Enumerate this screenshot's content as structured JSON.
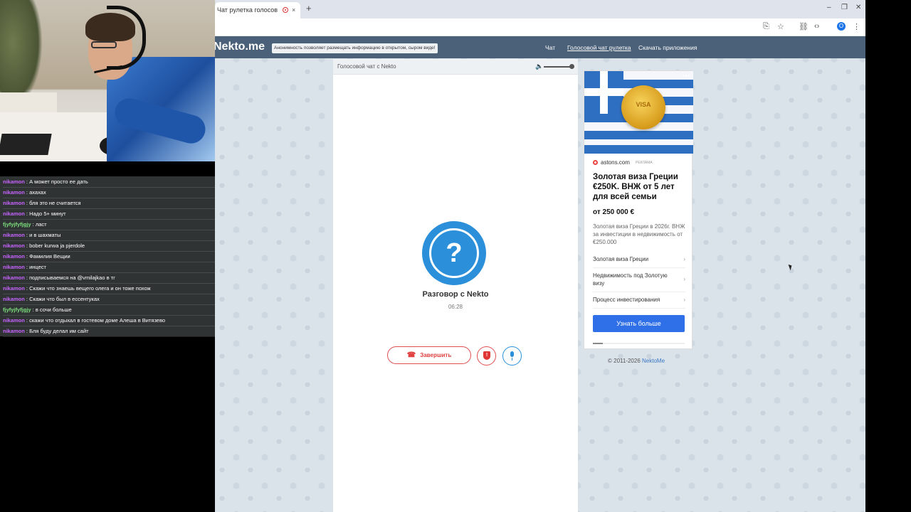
{
  "browser": {
    "tab_title": "Чат рулетка голосов",
    "tab_close": "×",
    "new_tab": "+",
    "win_minimize": "–",
    "win_restore": "❐",
    "win_close": "✕",
    "profile_initial": "O"
  },
  "site": {
    "logo": "Nekto.me",
    "anon_notice": "Анонимность позволяет размещать информацию в открытом, сыром виде!",
    "nav": [
      "Чат",
      "Голосовой чат рулетка",
      "Скачать приложения"
    ]
  },
  "chat": {
    "header_title": "Голосовой чат с Nekto",
    "avatar_symbol": "?",
    "conversation_title": "Разговор с Nekto",
    "timer": "06:28",
    "end_button": "Завершить",
    "end_icon": "☎",
    "shield_icon": "!"
  },
  "ad": {
    "image_text": "VISA",
    "menu_dots": "•••",
    "source": "astons.com",
    "label": "РЕКЛАМА",
    "title": "Золотая виза Греции €250K. ВНЖ от 5 лет для всей семьи",
    "price": "от 250 000 €",
    "description": "Золотая виза Греции в 2026г. ВНЖ за инвестиции в недвижимость от €250.000",
    "links": [
      "Золотая виза Греции",
      "Недвижимость под Золотую визу",
      "Процесс инвестирования"
    ],
    "chevron": "›",
    "cta": "Узнать больше",
    "progress": 0.11
  },
  "footer": {
    "copyright": "© 2011-2026 ",
    "brand": "NektoMe"
  },
  "stream_chat": [
    {
      "user": "nikamon",
      "msg": " : А может просто ее дать",
      "color": "#c864ff"
    },
    {
      "user": "nikamon",
      "msg": " : ахахах",
      "color": "#c864ff"
    },
    {
      "user": "nikamon",
      "msg": " : бля это не считается",
      "color": "#c864ff"
    },
    {
      "user": "nikamon",
      "msg": " : Надо 5+ минут",
      "color": "#c864ff"
    },
    {
      "user": "fjyfyjfyfjgjy",
      "msg": " : ласт",
      "color": "#7ee07e"
    },
    {
      "user": "nikamon",
      "msg": " : и в шахматы",
      "color": "#c864ff"
    },
    {
      "user": "nikamon",
      "msg": " : bober kurwa ja pjerdole",
      "color": "#c864ff"
    },
    {
      "user": "nikamon",
      "msg": " : Фамилия Вещии",
      "color": "#c864ff"
    },
    {
      "user": "nikamon",
      "msg": " : инцест",
      "color": "#c864ff"
    },
    {
      "user": "nikamon",
      "msg": " : подписываемся на @vmilajkao в тг",
      "color": "#c864ff"
    },
    {
      "user": "nikamon",
      "msg": " : Скажи что знаешь вещего олега и он тоже похож",
      "color": "#c864ff"
    },
    {
      "user": "nikamon",
      "msg": " : Скажи что был в ессентуках",
      "color": "#c864ff"
    },
    {
      "user": "fjyfyjfyfjgjy",
      "msg": " : в сочи больше",
      "color": "#7ee07e"
    },
    {
      "user": "nikamon",
      "msg": " : скажи что отдыхал в гостевом доме Алеша в Витязево",
      "color": "#c864ff"
    },
    {
      "user": "nikamon",
      "msg": " : Бля буду делал им сайт",
      "color": "#c864ff"
    }
  ]
}
